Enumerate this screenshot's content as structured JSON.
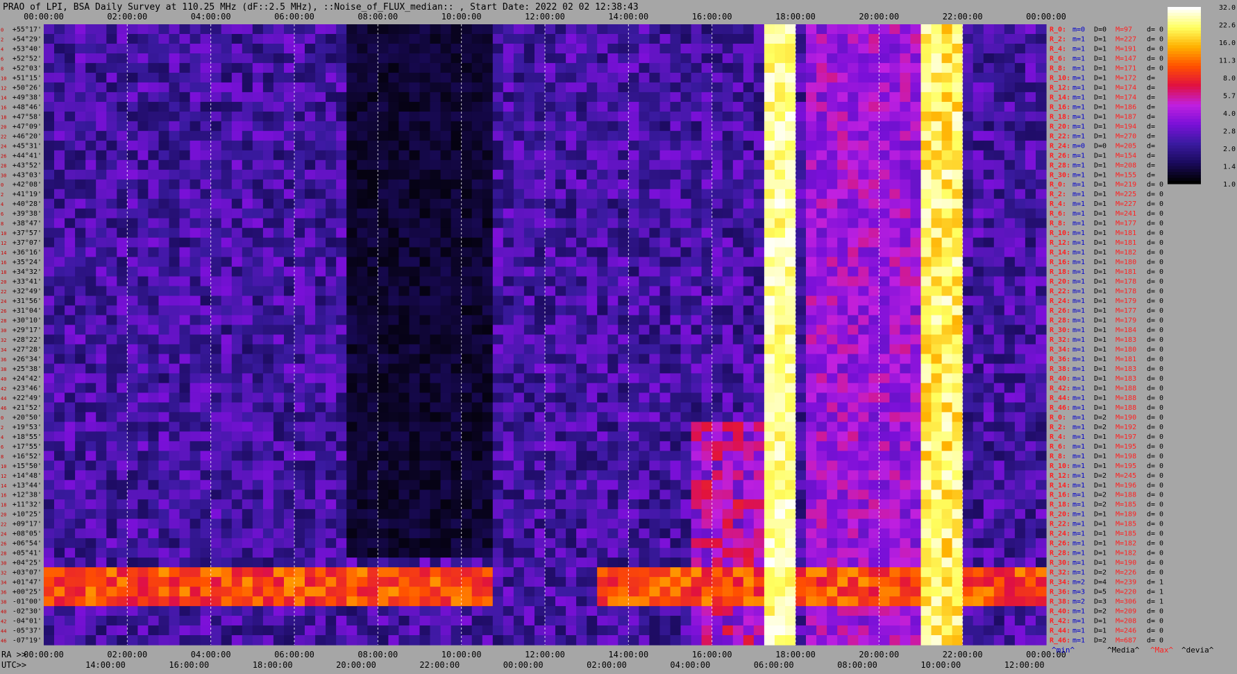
{
  "title": "PRAO of LPI, BSA Daily Survey at 110.25 MHz (dF::2.5 MHz), ::Noise_of_FLUX_median:: , Start Date: 2022 02 02 12:38:43",
  "chart_data": {
    "type": "heatmap",
    "x_top_ticks": [
      "00:00:00",
      "02:00:00",
      "04:00:00",
      "06:00:00",
      "08:00:00",
      "10:00:00",
      "12:00:00",
      "14:00:00",
      "16:00:00",
      "18:00:00",
      "20:00:00",
      "22:00:00",
      "00:00:00"
    ],
    "x_bottom_ra_prefix": "RA >>",
    "x_bottom_ra_ticks": [
      "00:00:00",
      "02:00:00",
      "04:00:00",
      "06:00:00",
      "08:00:00",
      "10:00:00",
      "12:00:00",
      "14:00:00",
      "16:00:00",
      "18:00:00",
      "20:00:00",
      "22:00:00",
      "00:00:00"
    ],
    "x_bottom_utc_prefix": "UTC>>",
    "x_bottom_utc_ticks": [
      "14:00:00",
      "16:00:00",
      "18:00:00",
      "20:00:00",
      "22:00:00",
      "00:00:00",
      "02:00:00",
      "04:00:00",
      "06:00:00",
      "08:00:00",
      "10:00:00",
      "12:00:00"
    ],
    "y_declinations": [
      "+55°17'",
      "+54°29'",
      "+53°40'",
      "+52°52'",
      "+52°03'",
      "+51°15'",
      "+50°26'",
      "+49°38'",
      "+48°46'",
      "+47°58'",
      "+47°09'",
      "+46°20'",
      "+45°31'",
      "+44°41'",
      "+43°52'",
      "+43°03'",
      "+42°08'",
      "+41°19'",
      "+40°28'",
      "+39°38'",
      "+38°47'",
      "+37°57'",
      "+37°07'",
      "+36°16'",
      "+35°24'",
      "+34°32'",
      "+33°41'",
      "+32°49'",
      "+31°56'",
      "+31°04'",
      "+30°10'",
      "+29°17'",
      "+28°22'",
      "+27°28'",
      "+26°34'",
      "+25°38'",
      "+24°42'",
      "+23°46'",
      "+22°49'",
      "+21°52'",
      "+20°50'",
      "+19°53'",
      "+18°55'",
      "+17°55'",
      "+16°52'",
      "+15°50'",
      "+14°48'",
      "+13°44'",
      "+12°38'",
      "+11°32'",
      "+10°25'",
      "+09°17'",
      "+08°05'",
      "+06°54'",
      "+05°41'",
      "+04°25'",
      "+03°07'",
      "+01°47'",
      "+00°25'",
      "-01°00'",
      "-02°30'",
      "-04°01'",
      "-05°37'",
      "-07°19'"
    ],
    "y_beam_index": [
      "0",
      "2",
      "4",
      "6",
      "8",
      "10",
      "12",
      "14",
      "16",
      "18",
      "20",
      "22",
      "24",
      "26",
      "28",
      "30",
      "0",
      "2",
      "4",
      "6",
      "8",
      "10",
      "12",
      "14",
      "16",
      "18",
      "20",
      "22",
      "24",
      "26",
      "28",
      "30",
      "32",
      "34",
      "36",
      "38",
      "40",
      "42",
      "44",
      "46",
      "0",
      "2",
      "4",
      "6",
      "8",
      "10",
      "12",
      "14",
      "16",
      "18",
      "20",
      "22",
      "24",
      "26",
      "28",
      "30",
      "32",
      "34",
      "36",
      "38",
      "40",
      "42",
      "44",
      "46"
    ],
    "right_stats": [
      {
        "r": "R_0:",
        "m": "m=0",
        "d": "D=0",
        "M": "M=97",
        "dev": "d= 0"
      },
      {
        "r": "R_2:",
        "m": "m=1",
        "d": "D=1",
        "M": "M=227",
        "dev": "d= 0"
      },
      {
        "r": "R_4:",
        "m": "m=1",
        "d": "D=1",
        "M": "M=191",
        "dev": "d= 0"
      },
      {
        "r": "R_6:",
        "m": "m=1",
        "d": "D=1",
        "M": "M=147",
        "dev": "d= 0"
      },
      {
        "r": "R_8:",
        "m": "m=1",
        "d": "D=1",
        "M": "M=171",
        "dev": "d= 0"
      },
      {
        "r": "R_10:",
        "m": "m=1",
        "d": "D=1",
        "M": "M=172",
        "dev": "d="
      },
      {
        "r": "R_12:",
        "m": "m=1",
        "d": "D=1",
        "M": "M=174",
        "dev": "d="
      },
      {
        "r": "R_14:",
        "m": "m=1",
        "d": "D=1",
        "M": "M=174",
        "dev": "d="
      },
      {
        "r": "R_16:",
        "m": "m=1",
        "d": "D=1",
        "M": "M=186",
        "dev": "d="
      },
      {
        "r": "R_18:",
        "m": "m=1",
        "d": "D=1",
        "M": "M=187",
        "dev": "d="
      },
      {
        "r": "R_20:",
        "m": "m=1",
        "d": "D=1",
        "M": "M=194",
        "dev": "d="
      },
      {
        "r": "R_22:",
        "m": "m=1",
        "d": "D=1",
        "M": "M=270",
        "dev": "d="
      },
      {
        "r": "R_24:",
        "m": "m=0",
        "d": "D=0",
        "M": "M=205",
        "dev": "d="
      },
      {
        "r": "R_26:",
        "m": "m=1",
        "d": "D=1",
        "M": "M=154",
        "dev": "d="
      },
      {
        "r": "R_28:",
        "m": "m=1",
        "d": "D=1",
        "M": "M=208",
        "dev": "d="
      },
      {
        "r": "R_30:",
        "m": "m=1",
        "d": "D=1",
        "M": "M=155",
        "dev": "d="
      },
      {
        "r": "R_0:",
        "m": "m=1",
        "d": "D=1",
        "M": "M=219",
        "dev": "d= 0"
      },
      {
        "r": "R_2:",
        "m": "m=1",
        "d": "D=1",
        "M": "M=225",
        "dev": "d= 0"
      },
      {
        "r": "R_4:",
        "m": "m=1",
        "d": "D=1",
        "M": "M=227",
        "dev": "d= 0"
      },
      {
        "r": "R_6:",
        "m": "m=1",
        "d": "D=1",
        "M": "M=241",
        "dev": "d= 0"
      },
      {
        "r": "R_8:",
        "m": "m=1",
        "d": "D=1",
        "M": "M=177",
        "dev": "d= 0"
      },
      {
        "r": "R_10:",
        "m": "m=1",
        "d": "D=1",
        "M": "M=181",
        "dev": "d= 0"
      },
      {
        "r": "R_12:",
        "m": "m=1",
        "d": "D=1",
        "M": "M=181",
        "dev": "d= 0"
      },
      {
        "r": "R_14:",
        "m": "m=1",
        "d": "D=1",
        "M": "M=182",
        "dev": "d= 0"
      },
      {
        "r": "R_16:",
        "m": "m=1",
        "d": "D=1",
        "M": "M=180",
        "dev": "d= 0"
      },
      {
        "r": "R_18:",
        "m": "m=1",
        "d": "D=1",
        "M": "M=181",
        "dev": "d= 0"
      },
      {
        "r": "R_20:",
        "m": "m=1",
        "d": "D=1",
        "M": "M=178",
        "dev": "d= 0"
      },
      {
        "r": "R_22:",
        "m": "m=1",
        "d": "D=1",
        "M": "M=178",
        "dev": "d= 0"
      },
      {
        "r": "R_24:",
        "m": "m=1",
        "d": "D=1",
        "M": "M=179",
        "dev": "d= 0"
      },
      {
        "r": "R_26:",
        "m": "m=1",
        "d": "D=1",
        "M": "M=177",
        "dev": "d= 0"
      },
      {
        "r": "R_28:",
        "m": "m=1",
        "d": "D=1",
        "M": "M=179",
        "dev": "d= 0"
      },
      {
        "r": "R_30:",
        "m": "m=1",
        "d": "D=1",
        "M": "M=184",
        "dev": "d= 0"
      },
      {
        "r": "R_32:",
        "m": "m=1",
        "d": "D=1",
        "M": "M=183",
        "dev": "d= 0"
      },
      {
        "r": "R_34:",
        "m": "m=1",
        "d": "D=1",
        "M": "M=180",
        "dev": "d= 0"
      },
      {
        "r": "R_36:",
        "m": "m=1",
        "d": "D=1",
        "M": "M=181",
        "dev": "d= 0"
      },
      {
        "r": "R_38:",
        "m": "m=1",
        "d": "D=1",
        "M": "M=183",
        "dev": "d= 0"
      },
      {
        "r": "R_40:",
        "m": "m=1",
        "d": "D=1",
        "M": "M=183",
        "dev": "d= 0"
      },
      {
        "r": "R_42:",
        "m": "m=1",
        "d": "D=1",
        "M": "M=188",
        "dev": "d= 0"
      },
      {
        "r": "R_44:",
        "m": "m=1",
        "d": "D=1",
        "M": "M=188",
        "dev": "d= 0"
      },
      {
        "r": "R_46:",
        "m": "m=1",
        "d": "D=1",
        "M": "M=188",
        "dev": "d= 0"
      },
      {
        "r": "R_0:",
        "m": "m=1",
        "d": "D=2",
        "M": "M=190",
        "dev": "d= 0"
      },
      {
        "r": "R_2:",
        "m": "m=1",
        "d": "D=2",
        "M": "M=192",
        "dev": "d= 0"
      },
      {
        "r": "R_4:",
        "m": "m=1",
        "d": "D=1",
        "M": "M=197",
        "dev": "d= 0"
      },
      {
        "r": "R_6:",
        "m": "m=1",
        "d": "D=1",
        "M": "M=195",
        "dev": "d= 0"
      },
      {
        "r": "R_8:",
        "m": "m=1",
        "d": "D=1",
        "M": "M=198",
        "dev": "d= 0"
      },
      {
        "r": "R_10:",
        "m": "m=1",
        "d": "D=1",
        "M": "M=195",
        "dev": "d= 0"
      },
      {
        "r": "R_12:",
        "m": "m=1",
        "d": "D=2",
        "M": "M=245",
        "dev": "d= 0"
      },
      {
        "r": "R_14:",
        "m": "m=1",
        "d": "D=1",
        "M": "M=196",
        "dev": "d= 0"
      },
      {
        "r": "R_16:",
        "m": "m=1",
        "d": "D=2",
        "M": "M=188",
        "dev": "d= 0"
      },
      {
        "r": "R_18:",
        "m": "m=1",
        "d": "D=2",
        "M": "M=185",
        "dev": "d= 0"
      },
      {
        "r": "R_20:",
        "m": "m=1",
        "d": "D=1",
        "M": "M=189",
        "dev": "d= 0"
      },
      {
        "r": "R_22:",
        "m": "m=1",
        "d": "D=1",
        "M": "M=185",
        "dev": "d= 0"
      },
      {
        "r": "R_24:",
        "m": "m=1",
        "d": "D=1",
        "M": "M=185",
        "dev": "d= 0"
      },
      {
        "r": "R_26:",
        "m": "m=1",
        "d": "D=1",
        "M": "M=182",
        "dev": "d= 0"
      },
      {
        "r": "R_28:",
        "m": "m=1",
        "d": "D=1",
        "M": "M=182",
        "dev": "d= 0"
      },
      {
        "r": "R_30:",
        "m": "m=1",
        "d": "D=1",
        "M": "M=190",
        "dev": "d= 0"
      },
      {
        "r": "R_32:",
        "m": "m=1",
        "d": "D=2",
        "M": "M=226",
        "dev": "d= 0"
      },
      {
        "r": "R_34:",
        "m": "m=2",
        "d": "D=4",
        "M": "M=239",
        "dev": "d= 1"
      },
      {
        "r": "R_36:",
        "m": "m=3",
        "d": "D=5",
        "M": "M=220",
        "dev": "d= 1"
      },
      {
        "r": "R_38:",
        "m": "m=2",
        "d": "D=3",
        "M": "M=306",
        "dev": "d= 1"
      },
      {
        "r": "R_40:",
        "m": "m=1",
        "d": "D=2",
        "M": "M=209",
        "dev": "d= 0"
      },
      {
        "r": "R_42:",
        "m": "m=1",
        "d": "D=1",
        "M": "M=208",
        "dev": "d= 0"
      },
      {
        "r": "R_44:",
        "m": "m=1",
        "d": "D=1",
        "M": "M=246",
        "dev": "d= 0"
      },
      {
        "r": "R_46:",
        "m": "m=1",
        "d": "D=2",
        "M": "M=687",
        "dev": "d= 0"
      }
    ],
    "legend_labels": [
      "^min^",
      "^Media^",
      "^Max^",
      "^devia^"
    ],
    "colorbar_ticks": [
      "32.0",
      "22.6",
      "16.0",
      "11.3",
      "8.0",
      "5.7",
      "4.0",
      "2.8",
      "2.0",
      "1.4",
      "1.0"
    ],
    "colorscale": "log",
    "colormap": [
      "#000000",
      "#1a0a5c",
      "#3a1aa0",
      "#7a10d8",
      "#c020e0",
      "#e01040",
      "#ff5000",
      "#ffb000",
      "#ffff60",
      "#ffffff"
    ],
    "colors": {
      "background": "#a6a6a6",
      "stat_label": "#ff2020",
      "stat_index": "#0000cc"
    }
  }
}
